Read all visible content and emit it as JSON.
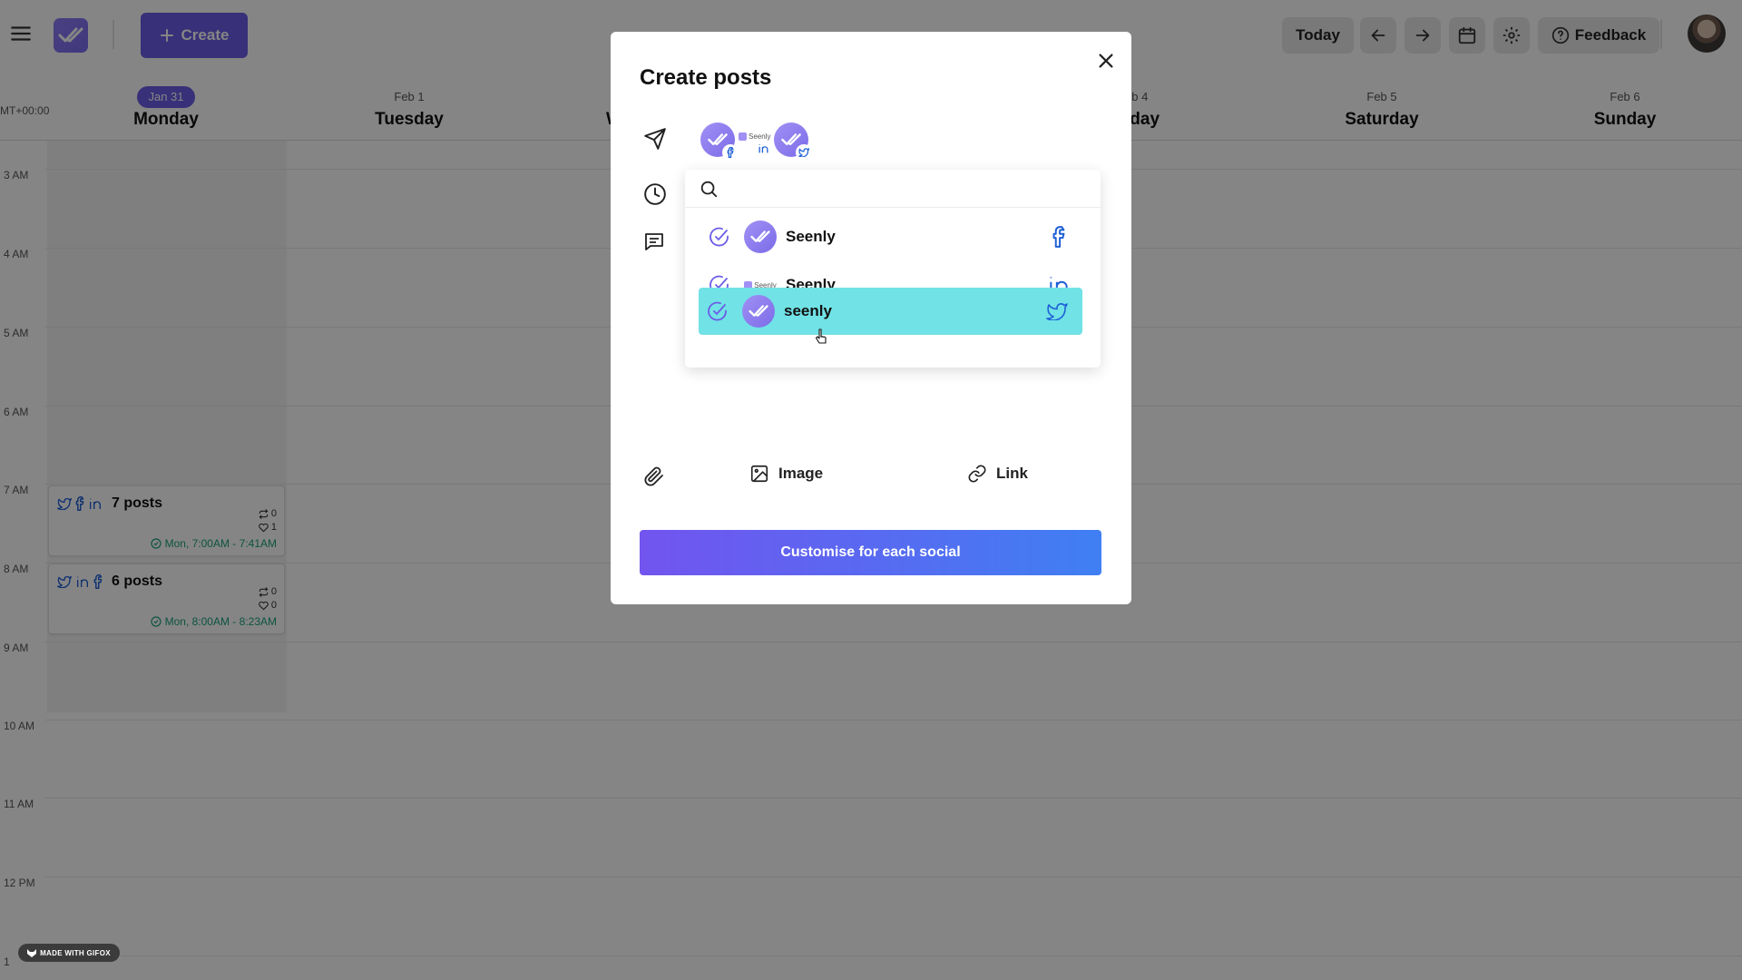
{
  "topbar": {
    "create_label": "Create",
    "today_label": "Today",
    "feedback_label": "Feedback"
  },
  "calendar": {
    "timezone": "MT+00:00",
    "days": [
      {
        "date": "Jan 31",
        "name": "Monday",
        "today": true
      },
      {
        "date": "Feb 1",
        "name": "Tuesday"
      },
      {
        "date": "",
        "name": "W"
      },
      {
        "date": "eb 4",
        "name": "iday"
      },
      {
        "date": "Feb 5",
        "name": "Saturday"
      },
      {
        "date": "Feb 6",
        "name": "Sunday"
      }
    ],
    "hours": [
      "3 AM",
      "4 AM",
      "5 AM",
      "6 AM",
      "7 AM",
      "8 AM",
      "9 AM",
      "10 AM",
      "11 AM",
      "12 PM",
      "1"
    ],
    "posts": [
      {
        "title": "7 posts",
        "reposts": "0",
        "likes": "1",
        "time": "Mon, 7:00AM - 7:41AM"
      },
      {
        "title": "6 posts",
        "reposts": "0",
        "likes": "0",
        "time": "Mon, 8:00AM - 8:23AM"
      }
    ]
  },
  "modal": {
    "title": "Create posts",
    "search_placeholder": "",
    "accounts": [
      {
        "name": "Seenly",
        "network": "facebook-icon",
        "selected": true
      },
      {
        "name": "Seenly",
        "network": "linkedin-icon",
        "selected": true
      },
      {
        "name": "seenly",
        "network": "twitter-icon",
        "selected": true,
        "hovered": true
      }
    ],
    "linkedin_logo_text": "Seenly",
    "image_label": "Image",
    "link_label": "Link",
    "cta_label": "Customise for each social"
  },
  "watermark": "MADE WITH GIFOX",
  "colors": {
    "accent": "#6b5ce7",
    "hover_row": "#71e2e6",
    "network_blue": "#1d5fd6",
    "time_green": "#1aa17c"
  }
}
